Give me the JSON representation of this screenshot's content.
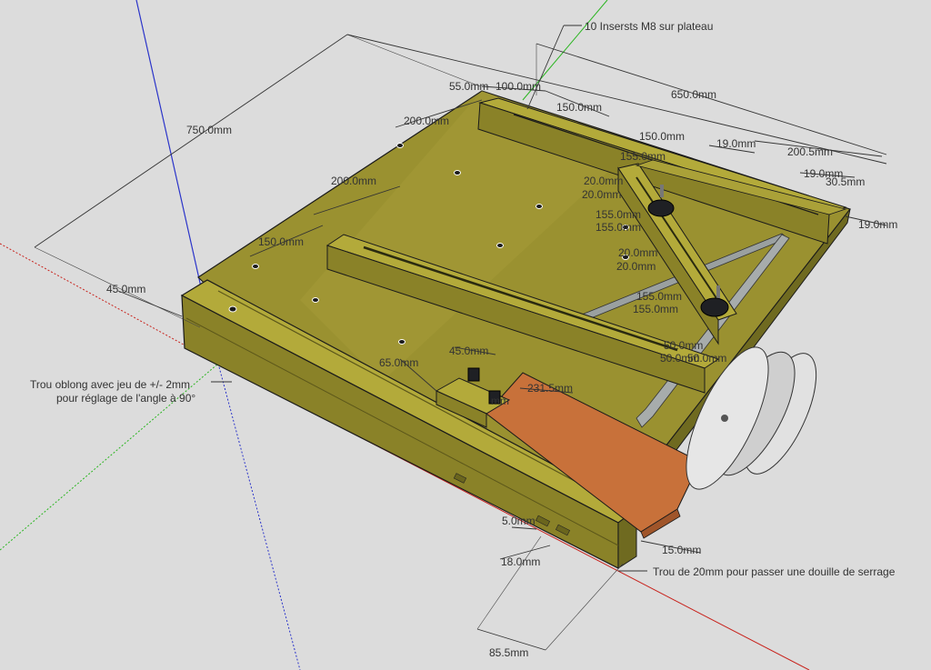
{
  "colors": {
    "background": "#dcdcdc",
    "wood_top": "#9a9130",
    "wood_side": "#7f7a24",
    "rail_top": "#b3aa3a",
    "copper_plate": "#c8713a",
    "blade": "#d8d8d8",
    "axis_blue": "#2b34c9",
    "axis_green": "#29b51f",
    "axis_red": "#c8231d",
    "knob": "#1f2024"
  },
  "dimensions": {
    "d750": "750.0mm",
    "d650": "650.0mm",
    "d55": "55.0mm",
    "d100": "100.0mm",
    "d150_top": "150.0mm",
    "d150_b": "150.0mm",
    "d200_a": "200.0mm",
    "d200_b": "200.0mm",
    "d150_left": "150.0mm",
    "d45_left": "45.0mm",
    "d19_a": "19.0mm",
    "d200_5": "200.5mm",
    "d19_b": "19.0mm",
    "d30_5": "30.5mm",
    "d19_c": "19.0mm",
    "d45_mid": "45.0mm",
    "d65": "65.0mm",
    "d231_5": "231.5mm",
    "d5": "5.0mm",
    "d18": "18.0mm",
    "d15": "15.0mm",
    "d85_5": "85.5mm",
    "d155_a": "155.0mm",
    "d155_b": "155.0mm",
    "d155_c": "155.0mm",
    "d155_d": "155.0mm",
    "d155_e": "155.0mm",
    "d155_f": "155.0mm",
    "d155_g": "155.0mm",
    "d20_a": "20.0mm",
    "d20_b": "20.0mm",
    "d20_c": "20.0mm",
    "d20_d": "20.0mm",
    "d50_a": "50.0mm",
    "d50_b": "50.0mm",
    "d50_c": "50.0mm",
    "d10_clip": "mm"
  },
  "annotations": {
    "inserts": "10 Insersts M8 sur plateau",
    "oblong_line1": "Trou oblong avec jeu de +/- 2mm",
    "oblong_line2": "pour réglage de l'angle à 90°",
    "hole_20": "Trou de 20mm pour passer une douille de serrage"
  }
}
